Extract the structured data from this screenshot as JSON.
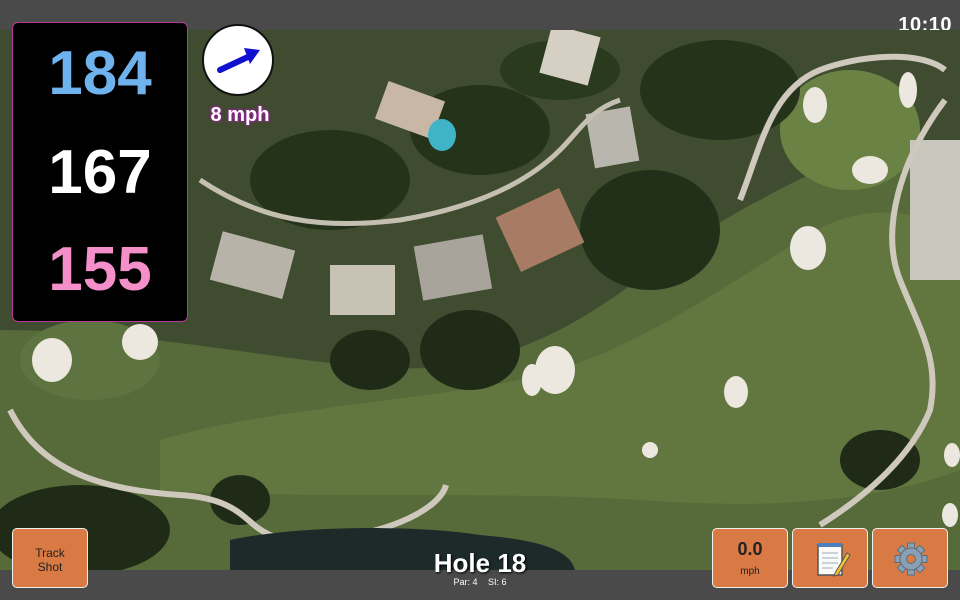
{
  "status": {
    "time": "10:10"
  },
  "yardages": {
    "back": {
      "value": "184",
      "color": "#6fb3ee"
    },
    "middle": {
      "value": "167",
      "color": "#ffffff"
    },
    "front": {
      "value": "155",
      "color": "#f48fc9"
    }
  },
  "wind": {
    "speed": "8 mph",
    "arrow_color": "#1010d0"
  },
  "hole": {
    "title": "Hole 18",
    "par": "Par: 4",
    "si": "SI: 6"
  },
  "buttons": {
    "track_shot_line1": "Track",
    "track_shot_line2": "Shot",
    "speed_value": "0.0",
    "speed_unit": "mph",
    "notes_icon": "notepad-icon",
    "settings_icon": "gear-icon"
  },
  "colors": {
    "button": "#d97a45",
    "bar": "#4a4a4a"
  }
}
